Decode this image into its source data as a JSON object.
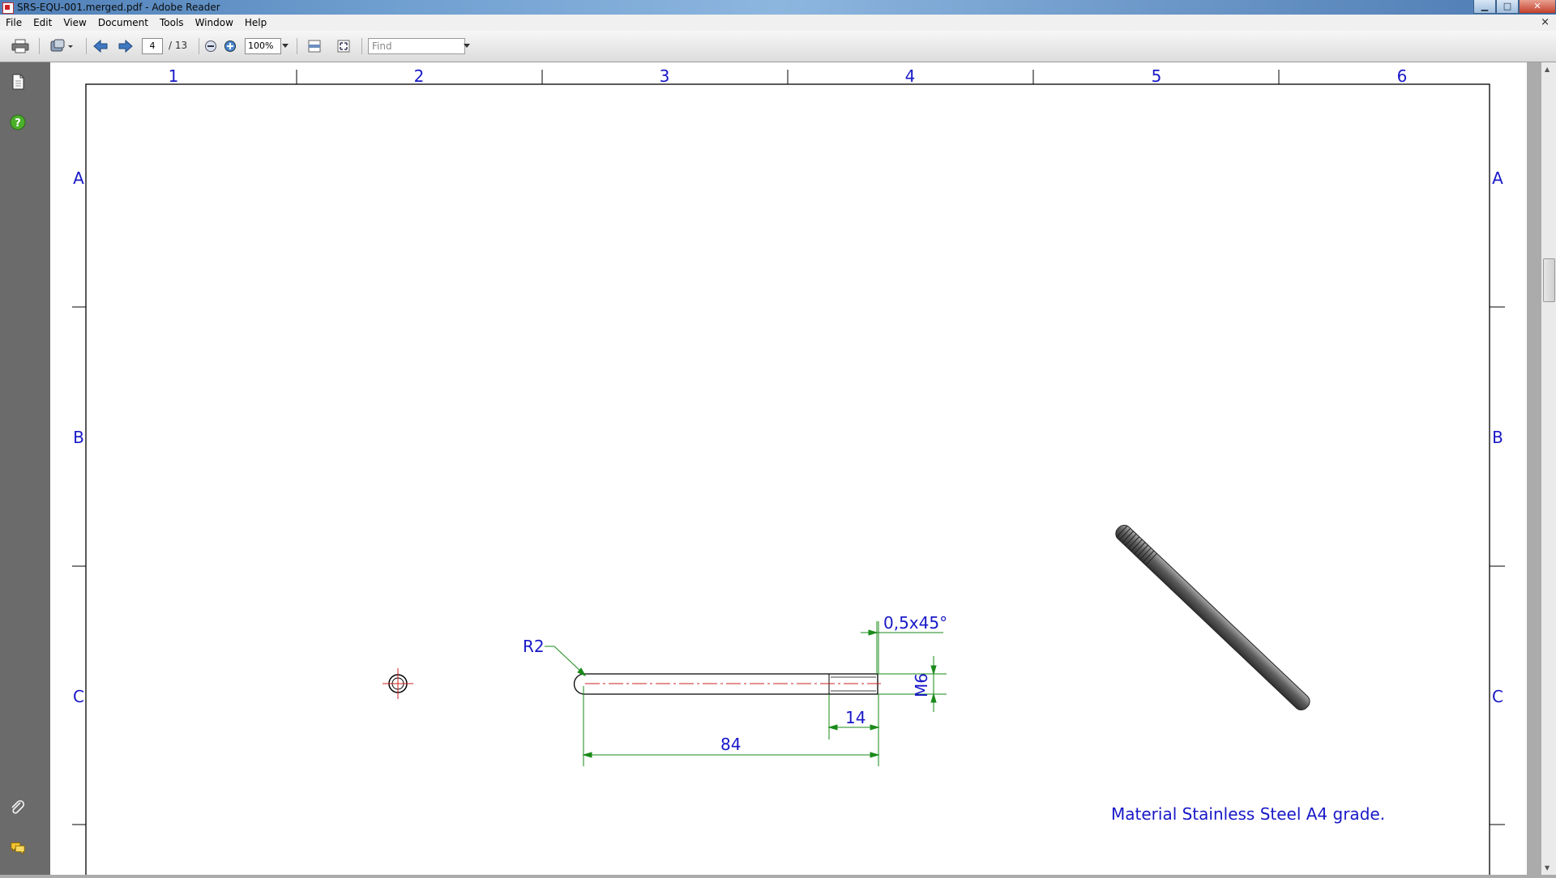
{
  "window": {
    "title": "SRS-EQU-001.merged.pdf - Adobe Reader",
    "buttons": {
      "minimize": "▁",
      "maximize": "□",
      "close": "✕"
    }
  },
  "menu": {
    "items": [
      "File",
      "Edit",
      "View",
      "Document",
      "Tools",
      "Window",
      "Help"
    ],
    "close_doc": "×"
  },
  "toolbar": {
    "page_current": "4",
    "page_total": "/ 13",
    "zoom": "100%",
    "find_placeholder": "Find"
  },
  "drawing": {
    "col_labels": [
      "1",
      "2",
      "3",
      "4",
      "5",
      "6"
    ],
    "row_labels": [
      "A",
      "B",
      "C"
    ],
    "dim_chamfer": "0,5x45°",
    "dim_radius": "R2",
    "dim_thread": "M6",
    "dim_thread_length": "14",
    "dim_overall_length": "84",
    "material_note": "Material Stainless Steel A4 grade.",
    "colors": {
      "label_blue": "#1818c8",
      "dimension_green": "#1a8a1a",
      "centerline_red": "#cc2020"
    }
  }
}
